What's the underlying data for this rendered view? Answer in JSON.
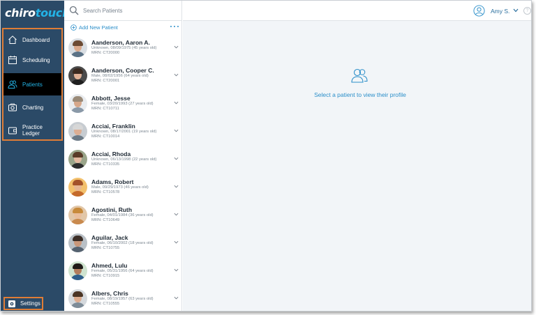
{
  "app": {
    "logo_part1": "chiro",
    "logo_part2": "touch"
  },
  "colors": {
    "sidebar": "#2b4a67",
    "accent": "#23b3e6",
    "link": "#2a8ec9",
    "highlight_border": "#e07d36"
  },
  "sidebar": {
    "items": [
      {
        "label": "Dashboard",
        "icon": "home-icon"
      },
      {
        "label": "Scheduling",
        "icon": "calendar-icon"
      },
      {
        "label": "Patients",
        "icon": "patients-icon",
        "active": true
      },
      {
        "label": "Charting",
        "icon": "camera-icon"
      },
      {
        "label": "Practice Ledger",
        "icon": "wallet-icon"
      }
    ],
    "settings_label": "Settings"
  },
  "search": {
    "placeholder": "Search Patients"
  },
  "list": {
    "add_label": "Add New Patient",
    "patients": [
      {
        "name": "Aanderson, Aaron A.",
        "details": "Unknown, 08/09/1975 (45 years old)",
        "mrn": "MRN: CT20000"
      },
      {
        "name": "Aanderson, Cooper C.",
        "details": "Male, 08/02/1956 (64 years old)",
        "mrn": "MRN: CT20001"
      },
      {
        "name": "Abbott, Jesse",
        "details": "Female, 03/20/1993 (27 years old)",
        "mrn": "MRN: CT10711"
      },
      {
        "name": "Acciai, Franklin",
        "details": "Unknown, 08/17/2001 (19 years old)",
        "mrn": "MRN: CT10014"
      },
      {
        "name": "Acciai, Rhoda",
        "details": "Unknown, 06/13/1998 (22 years old)",
        "mrn": "MRN: CT10335"
      },
      {
        "name": "Adams, Robert",
        "details": "Male, 09/29/1973 (46 years old)",
        "mrn": "MRN: CT10578"
      },
      {
        "name": "Agostini, Ruth",
        "details": "Female, 04/01/1984 (36 years old)",
        "mrn": "MRN: CT10649"
      },
      {
        "name": "Aguilar, Jack",
        "details": "Female, 06/10/2002 (18 years old)",
        "mrn": "MRN: CT10755"
      },
      {
        "name": "Ahmed, Lulu",
        "details": "Female, 05/31/1956 (64 years old)",
        "mrn": "MRN: CT10915"
      },
      {
        "name": "Albers, Chris",
        "details": "Female, 08/19/1957 (63 years old)",
        "mrn": "MRN: CT10555"
      }
    ]
  },
  "header": {
    "user_name": "Amy S.",
    "help_glyph": "?"
  },
  "main": {
    "empty_message": "Select a patient to view their profile"
  }
}
